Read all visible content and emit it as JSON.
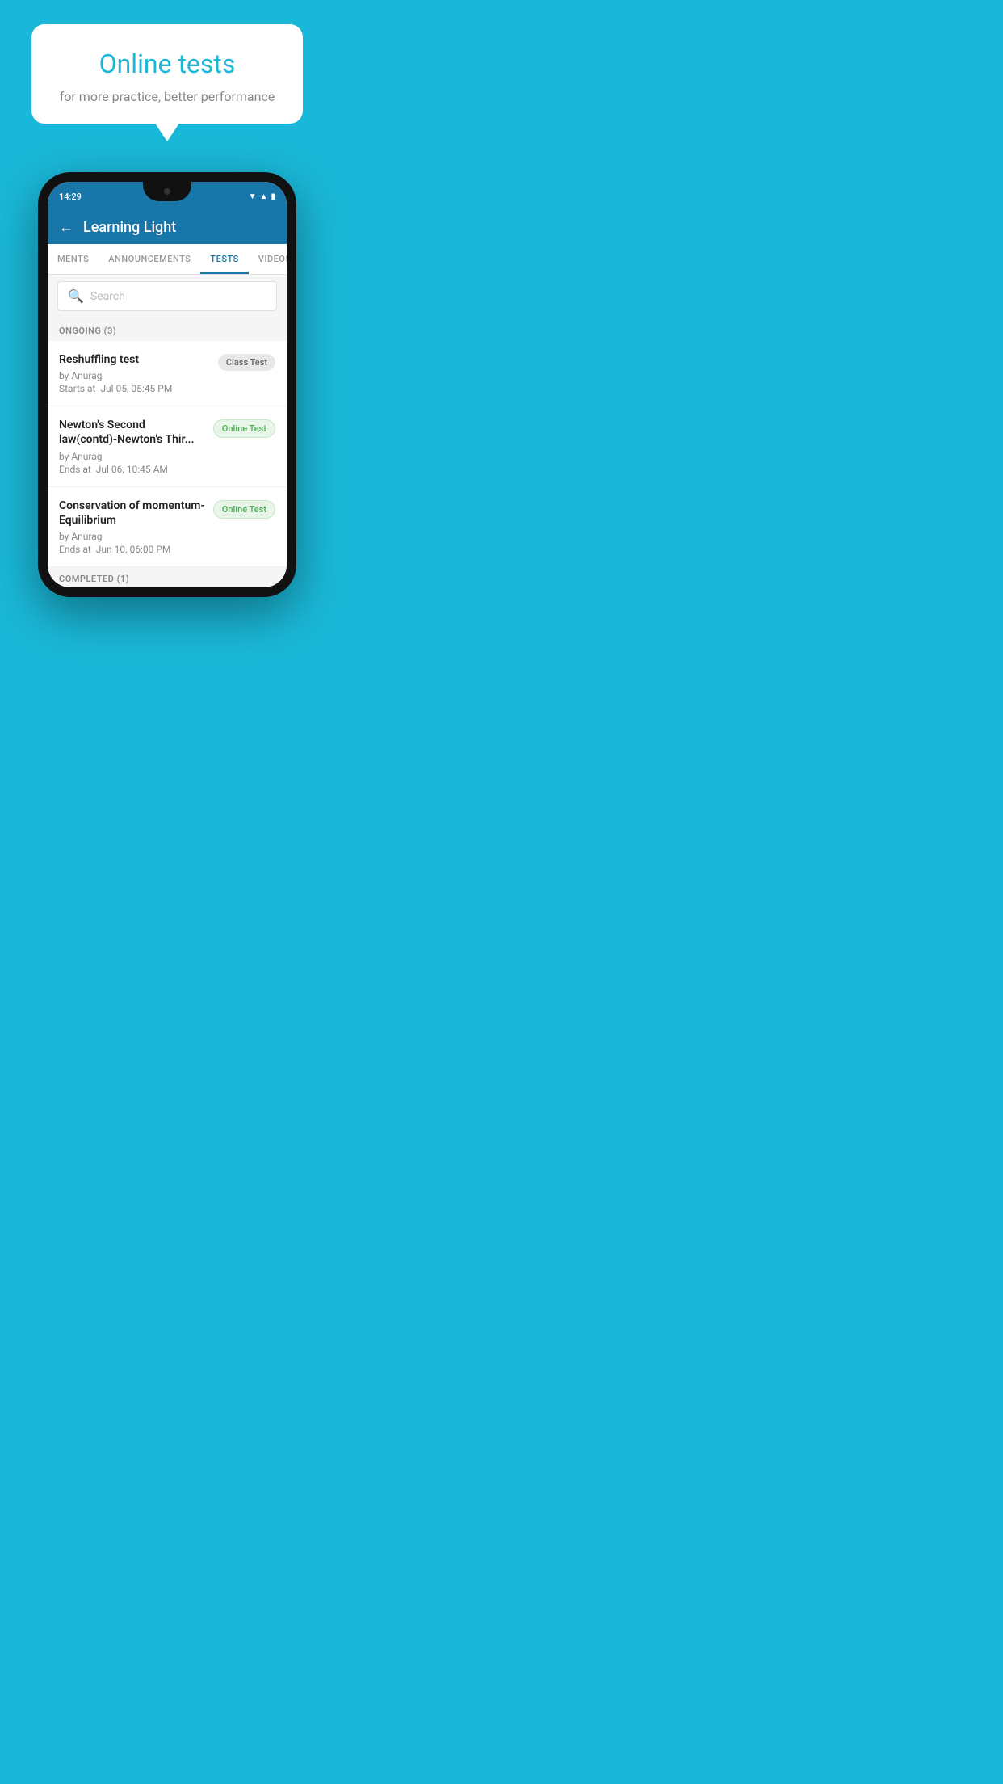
{
  "background": {
    "color": "#1ab8d8"
  },
  "speech_bubble": {
    "title": "Online tests",
    "subtitle": "for more practice, better performance"
  },
  "phone": {
    "status_bar": {
      "time": "14:29",
      "icons": [
        "wifi",
        "signal",
        "battery"
      ]
    },
    "header": {
      "title": "Learning Light",
      "back_label": "←"
    },
    "tabs": [
      {
        "label": "MENTS",
        "active": false
      },
      {
        "label": "ANNOUNCEMENTS",
        "active": false
      },
      {
        "label": "TESTS",
        "active": true
      },
      {
        "label": "VIDEOS",
        "active": false
      }
    ],
    "search": {
      "placeholder": "Search"
    },
    "sections": [
      {
        "header": "ONGOING (3)",
        "items": [
          {
            "name": "Reshuffling test",
            "author": "by Anurag",
            "time_label": "Starts at",
            "time": "Jul 05, 05:45 PM",
            "badge": "Class Test",
            "badge_type": "class"
          },
          {
            "name": "Newton's Second law(contd)-Newton's Thir...",
            "author": "by Anurag",
            "time_label": "Ends at",
            "time": "Jul 06, 10:45 AM",
            "badge": "Online Test",
            "badge_type": "online"
          },
          {
            "name": "Conservation of momentum-Equilibrium",
            "author": "by Anurag",
            "time_label": "Ends at",
            "time": "Jun 10, 06:00 PM",
            "badge": "Online Test",
            "badge_type": "online"
          }
        ]
      }
    ],
    "completed_section": "COMPLETED (1)"
  }
}
